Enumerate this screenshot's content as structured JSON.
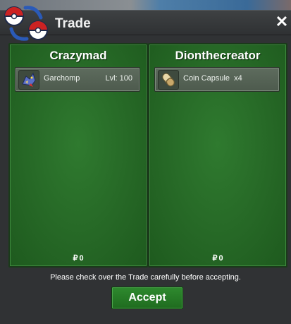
{
  "window": {
    "title": "Trade",
    "close_label": "✕"
  },
  "traders": [
    {
      "name": "Crazymad",
      "item": {
        "name": "Garchomp",
        "level": "Lvl: 100",
        "icon": "garchomp-sprite-icon"
      },
      "money": "0",
      "money_symbol": "₽"
    },
    {
      "name": "Dionthecreator",
      "item": {
        "name": "Coin Capsule  x4",
        "icon": "coin-capsule-icon"
      },
      "money": "0",
      "money_symbol": "₽"
    }
  ],
  "notice": "Please check over the Trade carefully before accepting.",
  "accept_label": "Accept",
  "colors": {
    "panel": "#266826",
    "accent": "#2e8a2e",
    "window": "#303234"
  }
}
